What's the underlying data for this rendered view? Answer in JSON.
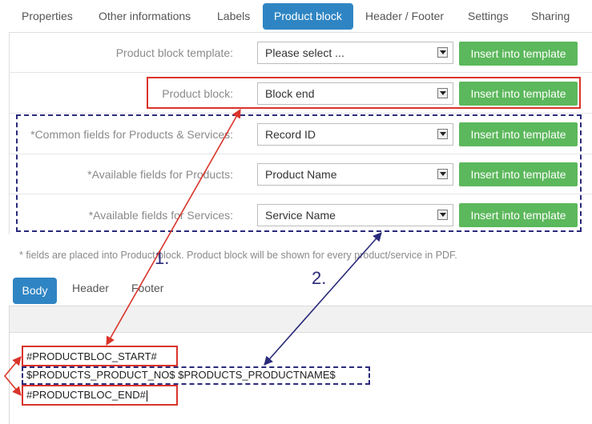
{
  "tabs": [
    {
      "label": "Properties"
    },
    {
      "label": "Other informations"
    },
    {
      "label": "Labels"
    },
    {
      "label": "Product block",
      "active": true
    },
    {
      "label": "Header / Footer"
    },
    {
      "label": "Settings"
    },
    {
      "label": "Sharing"
    }
  ],
  "form": {
    "rows": [
      {
        "label": "Product block template:",
        "value": "Please select ...",
        "button": "Insert into template"
      },
      {
        "label": "Product block:",
        "value": "Block end",
        "button": "Insert into template"
      },
      {
        "label": "*Common fields for Products & Services:",
        "value": "Record ID",
        "button": "Insert into template"
      },
      {
        "label": "*Available fields for Products:",
        "value": "Product Name",
        "button": "Insert into template"
      },
      {
        "label": "*Available fields for Services:",
        "value": "Service Name",
        "button": "Insert into template"
      }
    ],
    "note": "* fields are placed into Product block. Product block will be shown for every product/service in PDF."
  },
  "editor_tabs": [
    {
      "label": "Body",
      "active": true
    },
    {
      "label": "Header"
    },
    {
      "label": "Footer"
    }
  ],
  "editor": {
    "lines": [
      "#PRODUCTBLOC_START#",
      "$PRODUCTS_PRODUCT_NO$ $PRODUCTS_PRODUCTNAME$",
      "#PRODUCTBLOC_END#"
    ]
  },
  "annotations": {
    "step1": "1.",
    "step2": "2.",
    "red_color": "#d9342b",
    "blue_color": "#2a2a7a",
    "accent_color": "#2f85c3",
    "button_color": "#5cb85c"
  }
}
